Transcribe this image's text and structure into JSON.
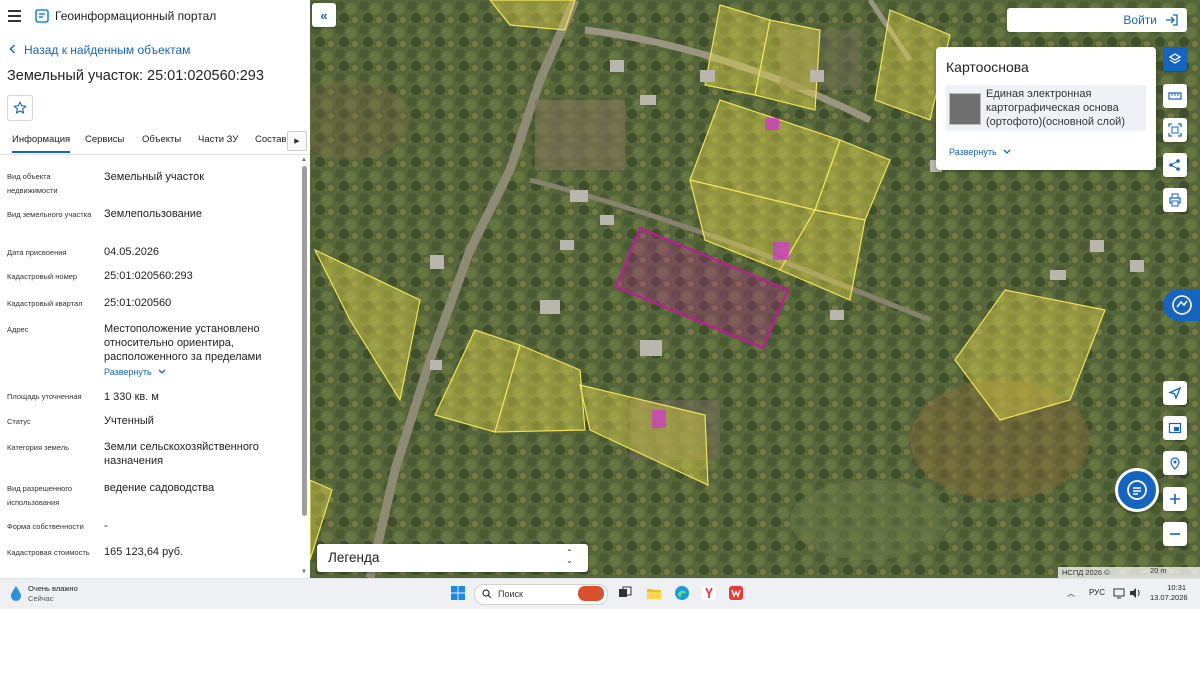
{
  "app": {
    "title": "Геоинформационный портал"
  },
  "nav": {
    "back": "Назад к найденным объектам"
  },
  "page": {
    "title": "Земельный участок: 25:01:020560:293"
  },
  "tabs": [
    "Информация",
    "Сервисы",
    "Объекты",
    "Части ЗУ",
    "Состав"
  ],
  "info": [
    {
      "label": "Вид объекта недвижимости",
      "value": "Земельный участок"
    },
    {
      "label": "Вид земельного участка",
      "value": "Землепользование"
    },
    {
      "label": "Дата присвоения",
      "value": "04.05.2026"
    },
    {
      "label": "Кадастровый номер",
      "value": "25:01:020560:293"
    },
    {
      "label": "Кадастровый квартал",
      "value": "25:01:020560"
    },
    {
      "label": "Адрес",
      "value": "Местоположение установлено относительно ориентира, расположенного за пределами"
    },
    {
      "label": "Площадь уточненная",
      "value": "1 330 кв. м"
    },
    {
      "label": "Статус",
      "value": "Учтенный"
    },
    {
      "label": "Категория земель",
      "value": "Земли сельскохозяйственного назначения"
    },
    {
      "label": "Вид разрешенного использования",
      "value": "ведение садоводства"
    },
    {
      "label": "Форма собственности",
      "value": "-"
    },
    {
      "label": "Кадастровая стоимость",
      "value": "165 123,64 руб."
    }
  ],
  "address_expand": "Развернуть",
  "map": {
    "login": "Войти",
    "basemap": {
      "title": "Картооснова",
      "item": "Единая электронная картографическая основа (ортофото)(основной слой)",
      "expand": "Развернуть"
    },
    "legend": "Легенда",
    "attribution": "НСПД 2026 ©",
    "scale": "20 m",
    "colors": {
      "parcel_fill": "#e8d84a",
      "selected_outline": "#c2189a",
      "accent": "#1565c0"
    }
  },
  "taskbar": {
    "weather_title": "Очень влажно",
    "weather_sub": "Сейчас",
    "search": "Поиск",
    "lang": "РУС",
    "time": "10:31",
    "date": "13.07.2026"
  }
}
